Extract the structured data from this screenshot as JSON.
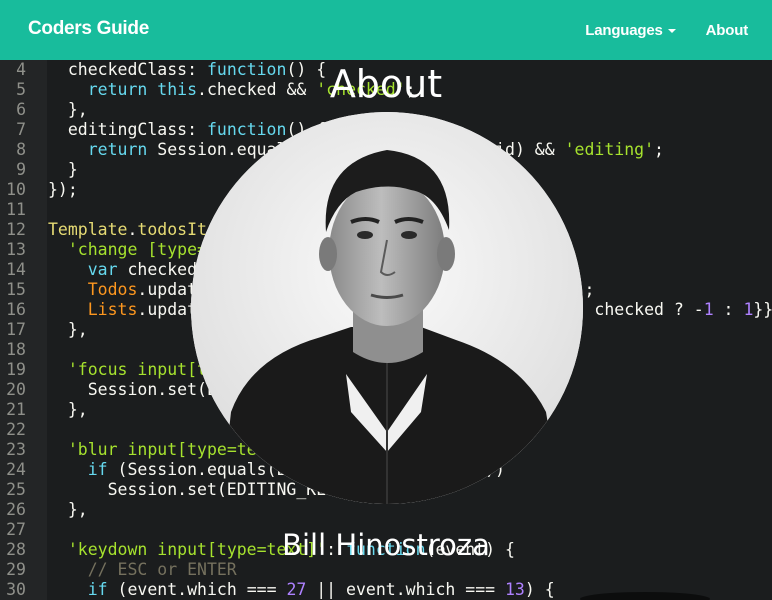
{
  "navbar": {
    "brand": "Coders Guide",
    "languages_label": "Languages",
    "about_label": "About",
    "bg_color": "#18bc9c"
  },
  "about": {
    "title": "About",
    "name": "Bill Hinostroza"
  },
  "code_lines": [
    {
      "n": "4",
      "t": "  checkedClass: function() {"
    },
    {
      "n": "5",
      "t": "    return this.checked && 'checked';"
    },
    {
      "n": "6",
      "t": "  },"
    },
    {
      "n": "7",
      "t": "  editingClass: function() {"
    },
    {
      "n": "8",
      "t": "    return Session.equals(EDITING_KEY, this._id) && 'editing';"
    },
    {
      "n": "9",
      "t": "  }"
    },
    {
      "n": "10",
      "t": "});"
    },
    {
      "n": "11",
      "t": ""
    },
    {
      "n": "12",
      "t": "Template.todosItem.events({"
    },
    {
      "n": "13",
      "t": "  'change [type=checkbox]': function(event) {"
    },
    {
      "n": "14",
      "t": "    var checked = $(event.target).is(':checked');"
    },
    {
      "n": "15",
      "t": "    Todos.update(this._id, {$set: {checked: checked}});"
    },
    {
      "n": "16",
      "t": "    Lists.update(this.listId, {$inc: {incompleteCount: checked ? -1 : 1}});"
    },
    {
      "n": "17",
      "t": "  },"
    },
    {
      "n": "18",
      "t": ""
    },
    {
      "n": "19",
      "t": "  'focus input[type=text]': function(event) {"
    },
    {
      "n": "20",
      "t": "    Session.set(EDITING_KEY, this._id);"
    },
    {
      "n": "21",
      "t": "  },"
    },
    {
      "n": "22",
      "t": ""
    },
    {
      "n": "23",
      "t": "  'blur input[type=text]': function(event) {"
    },
    {
      "n": "24",
      "t": "    if (Session.equals(EDITING_KEY, this._id))"
    },
    {
      "n": "25",
      "t": "      Session.set(EDITING_KEY, null);"
    },
    {
      "n": "26",
      "t": "  },"
    },
    {
      "n": "27",
      "t": ""
    },
    {
      "n": "28",
      "t": "  'keydown input[type=text]': function(event) {"
    },
    {
      "n": "29",
      "t": "    // ESC or ENTER"
    },
    {
      "n": "30",
      "t": "    if (event.which === 27 || event.which === 13) {"
    }
  ],
  "icons": {
    "languages_caret": "caret-down-icon"
  }
}
